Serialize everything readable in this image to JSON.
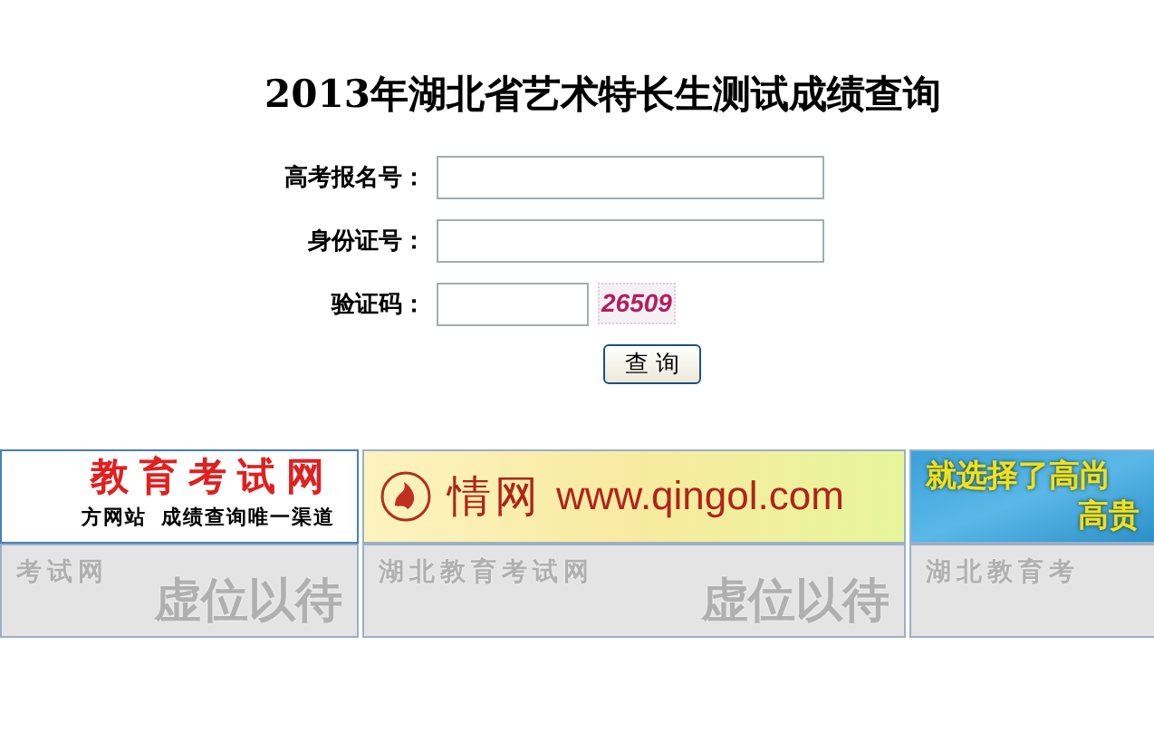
{
  "title": "2013年湖北省艺术特长生测试成绩查询",
  "fields": [
    {
      "label": "高考报名号：",
      "kind": "text"
    },
    {
      "label": "身份证号：",
      "kind": "text"
    },
    {
      "label": "验证码：",
      "kind": "captcha",
      "captcha": "26509"
    }
  ],
  "submit": "查 询",
  "ads": [
    {
      "kind": "exam",
      "lines": [
        "教育考试网",
        "方网站  成绩查询唯一渠道"
      ]
    },
    {
      "kind": "qingol",
      "lines": [
        "情网",
        "www.qingol.com"
      ]
    },
    {
      "kind": "sky",
      "lines": [
        "就选择了高尚",
        "高贵"
      ]
    }
  ],
  "placeholders": [
    {
      "lines": [
        "考试网",
        "虚位以待"
      ]
    },
    {
      "lines": [
        "湖北教育考试网",
        "虚位以待"
      ]
    },
    {
      "lines": [
        "湖北教育考"
      ]
    }
  ]
}
